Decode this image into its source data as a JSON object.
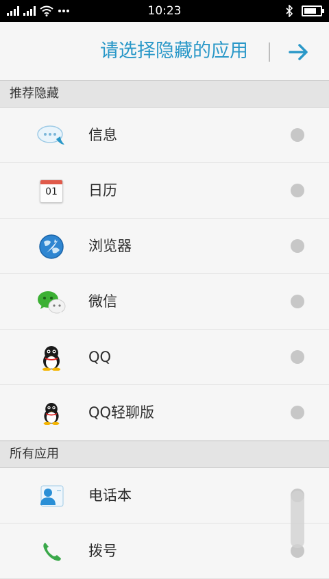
{
  "status_bar": {
    "time": "10:23",
    "battery_level": 0.75
  },
  "header": {
    "title": "请选择隐藏的应用",
    "next_icon": "arrow-right-icon",
    "accent": "#2a98c8"
  },
  "sections": [
    {
      "title": "推荐隐藏",
      "items": [
        {
          "label": "信息",
          "icon": "messages-icon"
        },
        {
          "label": "日历",
          "icon": "calendar-icon",
          "icon_text": "01"
        },
        {
          "label": "浏览器",
          "icon": "browser-icon"
        },
        {
          "label": "微信",
          "icon": "wechat-icon"
        },
        {
          "label": "QQ",
          "icon": "qq-penguin-icon"
        },
        {
          "label": "QQ轻聊版",
          "icon": "qq-lite-icon"
        }
      ]
    },
    {
      "title": "所有应用",
      "items": [
        {
          "label": "电话本",
          "icon": "contacts-icon"
        },
        {
          "label": "拨号",
          "icon": "dialer-icon"
        }
      ]
    }
  ]
}
